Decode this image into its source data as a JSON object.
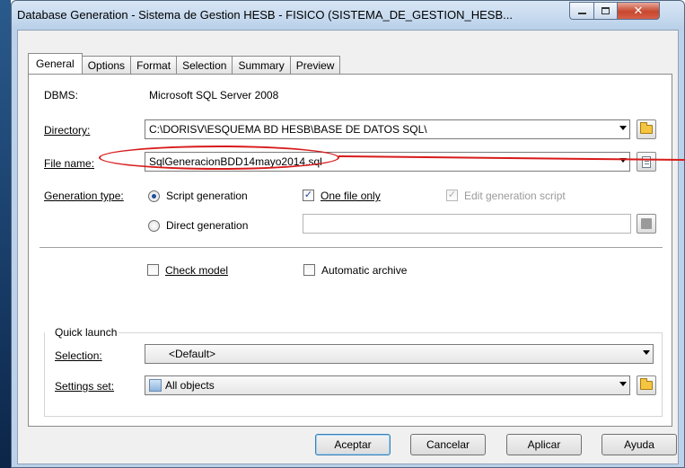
{
  "window": {
    "title": "Database Generation - Sistema de Gestion HESB - FISICO (SISTEMA_DE_GESTION_HESB..."
  },
  "tabs": [
    {
      "label": "General"
    },
    {
      "label": "Options"
    },
    {
      "label": "Format"
    },
    {
      "label": "Selection"
    },
    {
      "label": "Summary"
    },
    {
      "label": "Preview"
    }
  ],
  "general": {
    "dbms_label": "DBMS:",
    "dbms_value": "Microsoft SQL Server 2008",
    "directory_label": "Directory:",
    "directory_value": "C:\\DORISV\\ESQUEMA BD HESB\\BASE DE DATOS SQL\\",
    "filename_label": "File name:",
    "filename_value": "SqlGeneracionBDD14mayo2014.sql",
    "gentype_label": "Generation type:",
    "script_generation": "Script generation",
    "direct_generation": "Direct generation",
    "one_file_only": "One file only",
    "edit_generation_script": "Edit generation script",
    "check_model": "Check model",
    "automatic_archive": "Automatic archive"
  },
  "quick_launch": {
    "title": "Quick launch",
    "selection_label": "Selection:",
    "selection_value": "<Default>",
    "settings_label": "Settings set:",
    "settings_value": "All objects"
  },
  "buttons": {
    "accept": "Aceptar",
    "cancel": "Cancelar",
    "apply": "Aplicar",
    "help": "Ayuda"
  },
  "state": {
    "active_tab": "General",
    "generation_type": "Script generation",
    "one_file_only": true,
    "edit_generation_script": true,
    "check_model": false,
    "automatic_archive": false
  },
  "colors": {
    "annotation": "#d81b1b",
    "accent": "#1f4e99"
  }
}
